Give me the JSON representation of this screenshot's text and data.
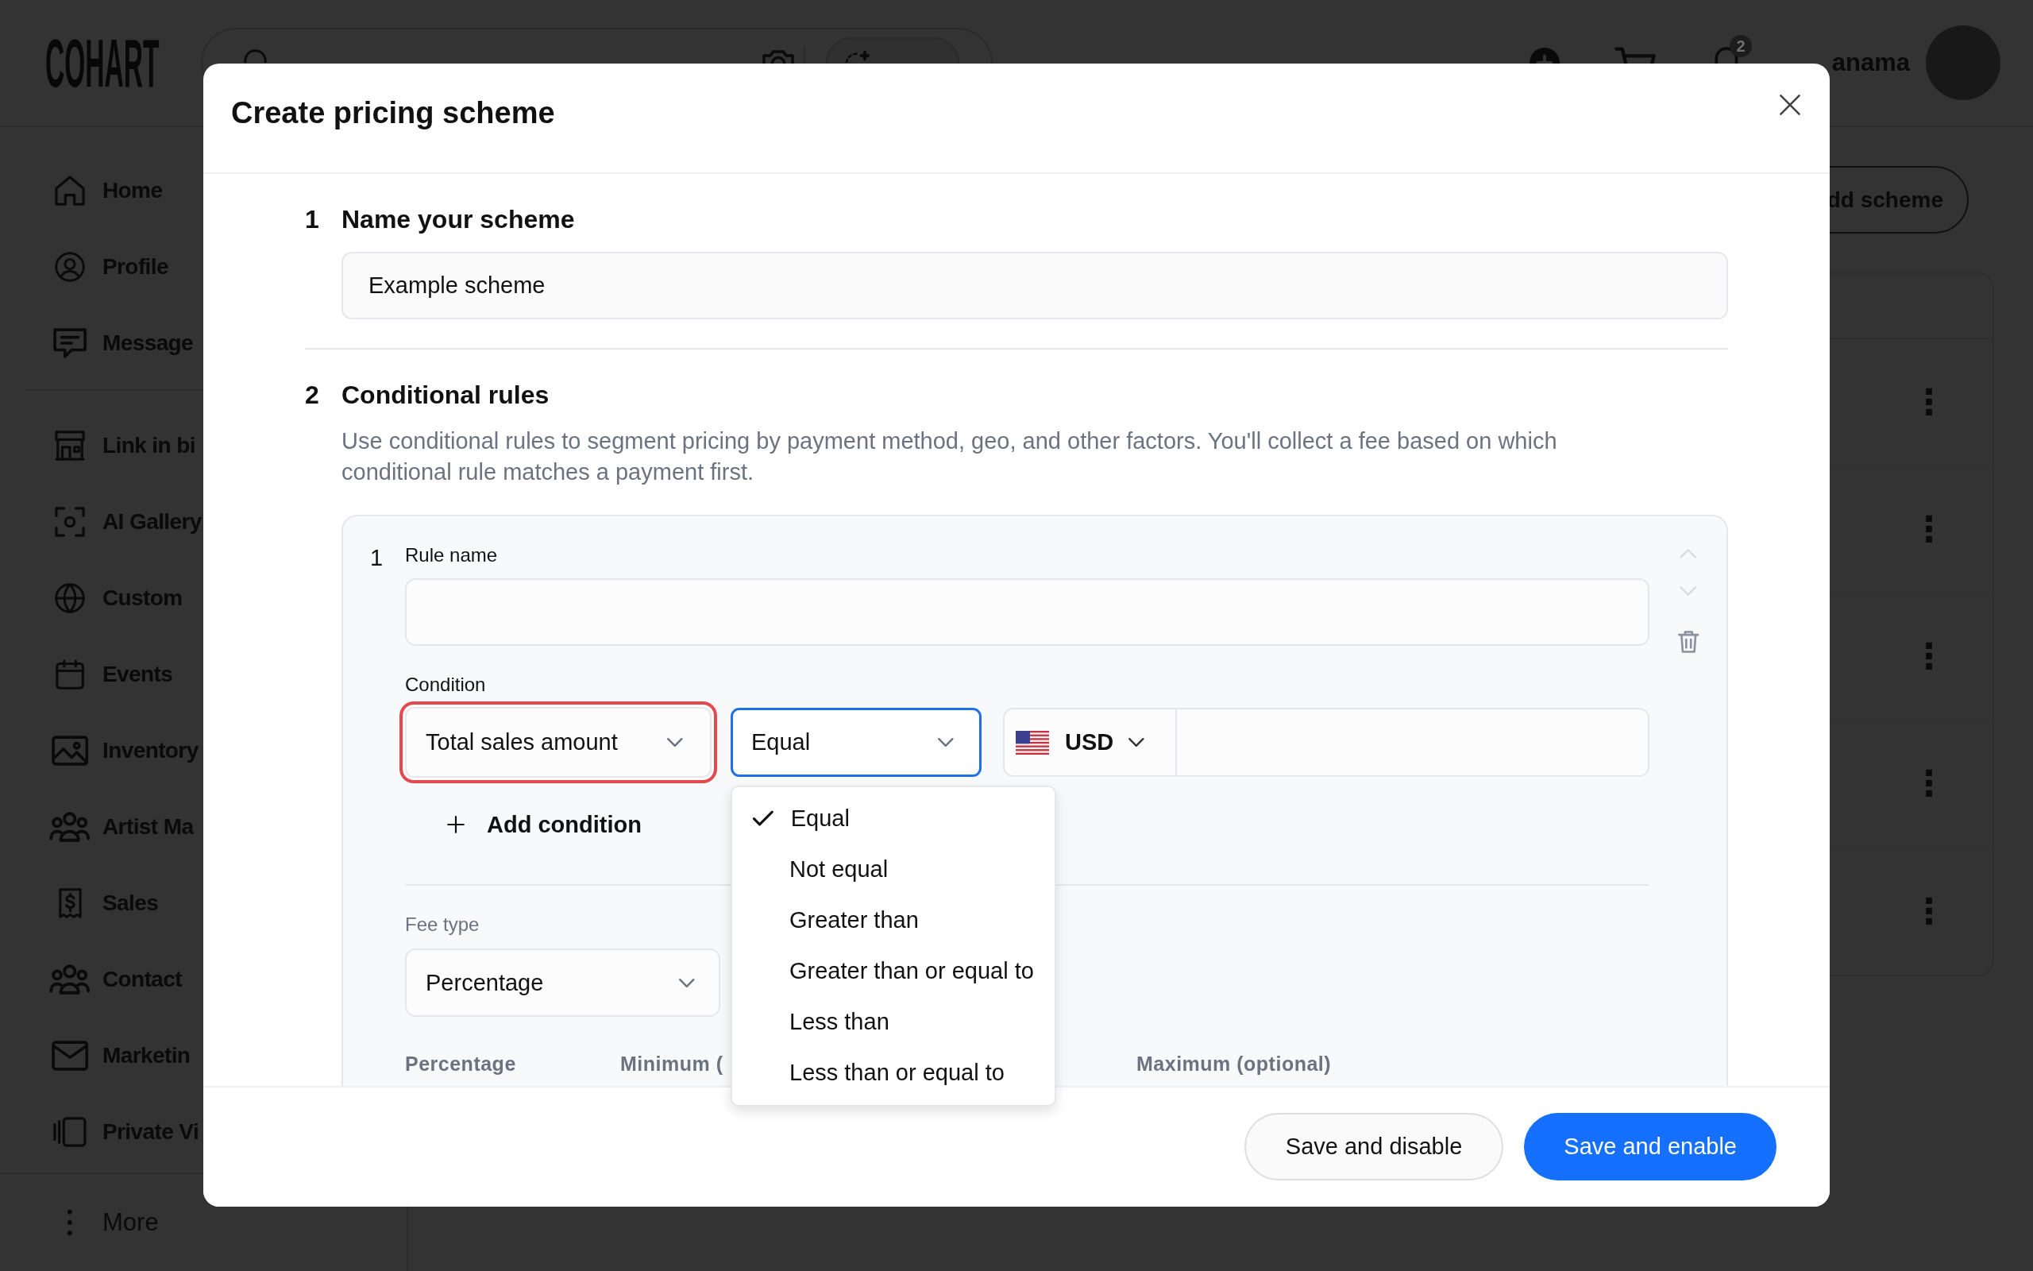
{
  "topbar": {
    "logo": "COHART",
    "notification_count": "2",
    "username": "anama"
  },
  "sidebar": {
    "groups": [
      {
        "items": [
          {
            "label": "Home"
          },
          {
            "label": "Profile"
          },
          {
            "label": "Message"
          }
        ]
      },
      {
        "items": [
          {
            "label": "Link in bi"
          },
          {
            "label": "AI Gallery"
          },
          {
            "label": "Custom"
          },
          {
            "label": "Events"
          },
          {
            "label": "Inventory"
          },
          {
            "label": "Artist Ma"
          },
          {
            "label": "Sales"
          },
          {
            "label": "Contact"
          },
          {
            "label": "Marketin"
          },
          {
            "label": "Private Vi"
          }
        ]
      }
    ],
    "more": "More"
  },
  "main": {
    "add_button": "dd scheme",
    "table": {
      "rows": [
        {
          "menu": "⋮"
        },
        {
          "menu": "⋮"
        },
        {
          "menu": "⋮"
        },
        {
          "menu": "⋮"
        },
        {
          "menu": "⋮"
        }
      ]
    }
  },
  "modal": {
    "title": "Create pricing scheme",
    "sections": [
      {
        "kind": "name",
        "number": "1",
        "title": "Name your scheme",
        "value": "Example scheme"
      },
      {
        "kind": "rules",
        "number": "2",
        "title": "Conditional rules",
        "description": "Use conditional rules to segment pricing by payment method, geo, and other factors. You'll collect a fee based on which conditional rule matches a payment first.",
        "rules": [
          {
            "number": "1",
            "name_label": "Rule name",
            "actions": [
              {
                "kind": "up",
                "disabled": true
              },
              {
                "kind": "down",
                "disabled": true
              },
              {
                "kind": "delete",
                "disabled": false
              }
            ],
            "condition": {
              "label": "Condition",
              "selects": [
                {
                  "value": "Total sales amount",
                  "invalid": true,
                  "open": false
                },
                {
                  "value": "Equal",
                  "invalid": false,
                  "open": true,
                  "options": [
                    {
                      "label": "Equal",
                      "selected": true
                    },
                    {
                      "label": "Not equal",
                      "selected": false
                    },
                    {
                      "label": "Greater than",
                      "selected": false
                    },
                    {
                      "label": "Greater than or equal to",
                      "selected": false
                    },
                    {
                      "label": "Less than",
                      "selected": false
                    },
                    {
                      "label": "Less than or equal to",
                      "selected": false
                    }
                  ]
                }
              ],
              "currency": "USD",
              "add_label": "Add condition"
            },
            "fee_type": {
              "label": "Fee type",
              "value": "Percentage"
            },
            "columns": [
              "Percentage",
              "Minimum (",
              "Maximum (optional)"
            ]
          }
        ]
      }
    ],
    "buttons": [
      {
        "label": "Save and disable",
        "kind": "secondary"
      },
      {
        "label": "Save and enable",
        "kind": "primary"
      }
    ]
  }
}
